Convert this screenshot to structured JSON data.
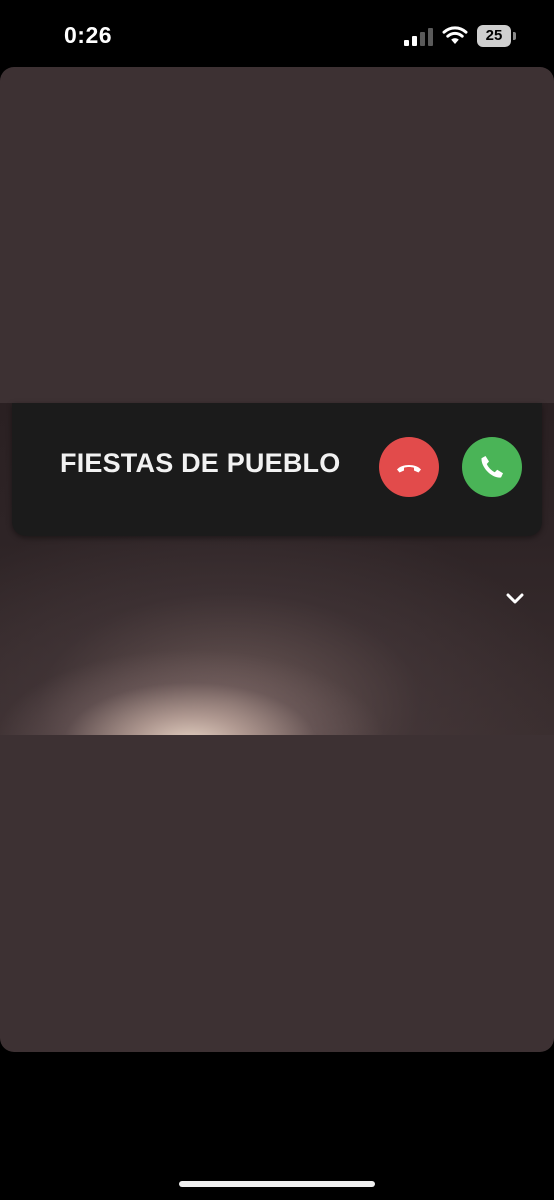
{
  "status_bar": {
    "time": "0:26",
    "battery_level": "25",
    "icons": [
      "signal-icon",
      "wifi-icon",
      "battery-icon"
    ]
  },
  "incoming_call": {
    "caller_name": "FIESTAS DE PUEBLO",
    "decline_icon": "phone-hangup-icon",
    "accept_icon": "phone-icon",
    "colors": {
      "decline": "#e24b4b",
      "accept": "#4ab457",
      "banner": "#1b1b1b"
    }
  },
  "controls": {
    "collapse_icon": "chevron-down-icon"
  },
  "colors": {
    "background": "#000000",
    "card": "#3d3133"
  }
}
